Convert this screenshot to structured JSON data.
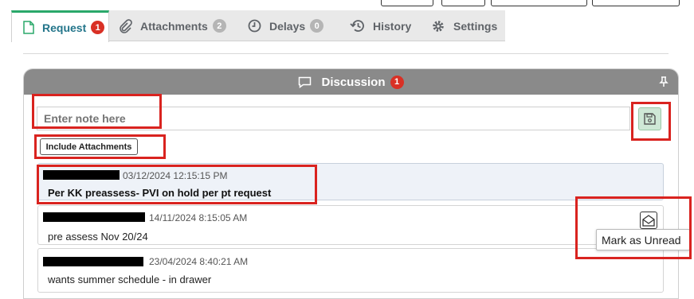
{
  "tabs": [
    {
      "label": "Request",
      "badge": "1",
      "icon": "document-icon"
    },
    {
      "label": "Attachments",
      "badge": "2",
      "icon": "paperclip-icon"
    },
    {
      "label": "Delays",
      "badge": "0",
      "icon": "clock-icon"
    },
    {
      "label": "History",
      "icon": "history-icon"
    },
    {
      "label": "Settings",
      "icon": "gear-icon"
    }
  ],
  "discussion": {
    "title": "Discussion",
    "badge": "1",
    "note_placeholder": "Enter note here",
    "include_attachments_label": "Include Attachments"
  },
  "entries": [
    {
      "timestamp": "03/12/2024 12:15:15 PM",
      "message": "Per KK preassess- PVI on hold per pt request"
    },
    {
      "timestamp": "14/11/2024 8:15:05 AM",
      "message": "pre assess Nov 20/24"
    },
    {
      "timestamp": "23/04/2024 8:40:21 AM",
      "message": "wants summer schedule - in drawer"
    }
  ],
  "tooltip": "Mark as Unread",
  "colors": {
    "active_tab": "#23758a",
    "active_tab_top": "#2aa86a",
    "badge_red": "#d93025",
    "badge_grey": "#b5b5b5",
    "header_bg": "#8a8a8a",
    "annotation": "#d9231f"
  }
}
